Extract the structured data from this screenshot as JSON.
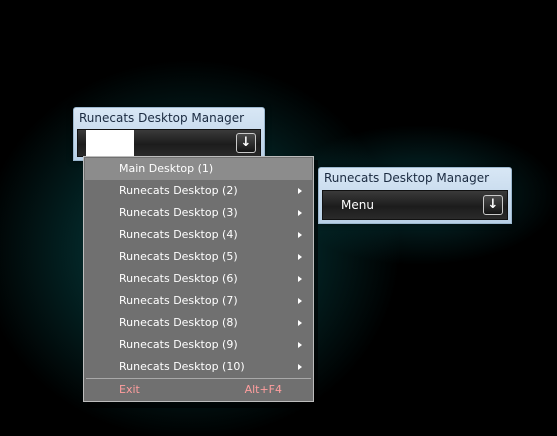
{
  "widget_left": {
    "title": "Runecats Desktop Manager",
    "button_icon": "download-arrow-icon"
  },
  "widget_right": {
    "title": "Runecats Desktop Manager",
    "label": "Menu",
    "button_icon": "download-arrow-icon"
  },
  "menu": {
    "items": [
      {
        "label": "Main Desktop (1)",
        "submenu": false
      },
      {
        "label": "Runecats Desktop (2)",
        "submenu": true
      },
      {
        "label": "Runecats Desktop (3)",
        "submenu": true
      },
      {
        "label": "Runecats Desktop (4)",
        "submenu": true
      },
      {
        "label": "Runecats Desktop (5)",
        "submenu": true
      },
      {
        "label": "Runecats Desktop (6)",
        "submenu": true
      },
      {
        "label": "Runecats Desktop (7)",
        "submenu": true
      },
      {
        "label": "Runecats Desktop (8)",
        "submenu": true
      },
      {
        "label": "Runecats Desktop (9)",
        "submenu": true
      },
      {
        "label": "Runecats Desktop (10)",
        "submenu": true
      }
    ],
    "exit_label": "Exit",
    "exit_shortcut": "Alt+F4"
  },
  "colors": {
    "menu_bg": "#707070",
    "menu_hover": "#8c8c8c",
    "exit_text": "#ff9e9e",
    "glow": "#0a7878"
  }
}
